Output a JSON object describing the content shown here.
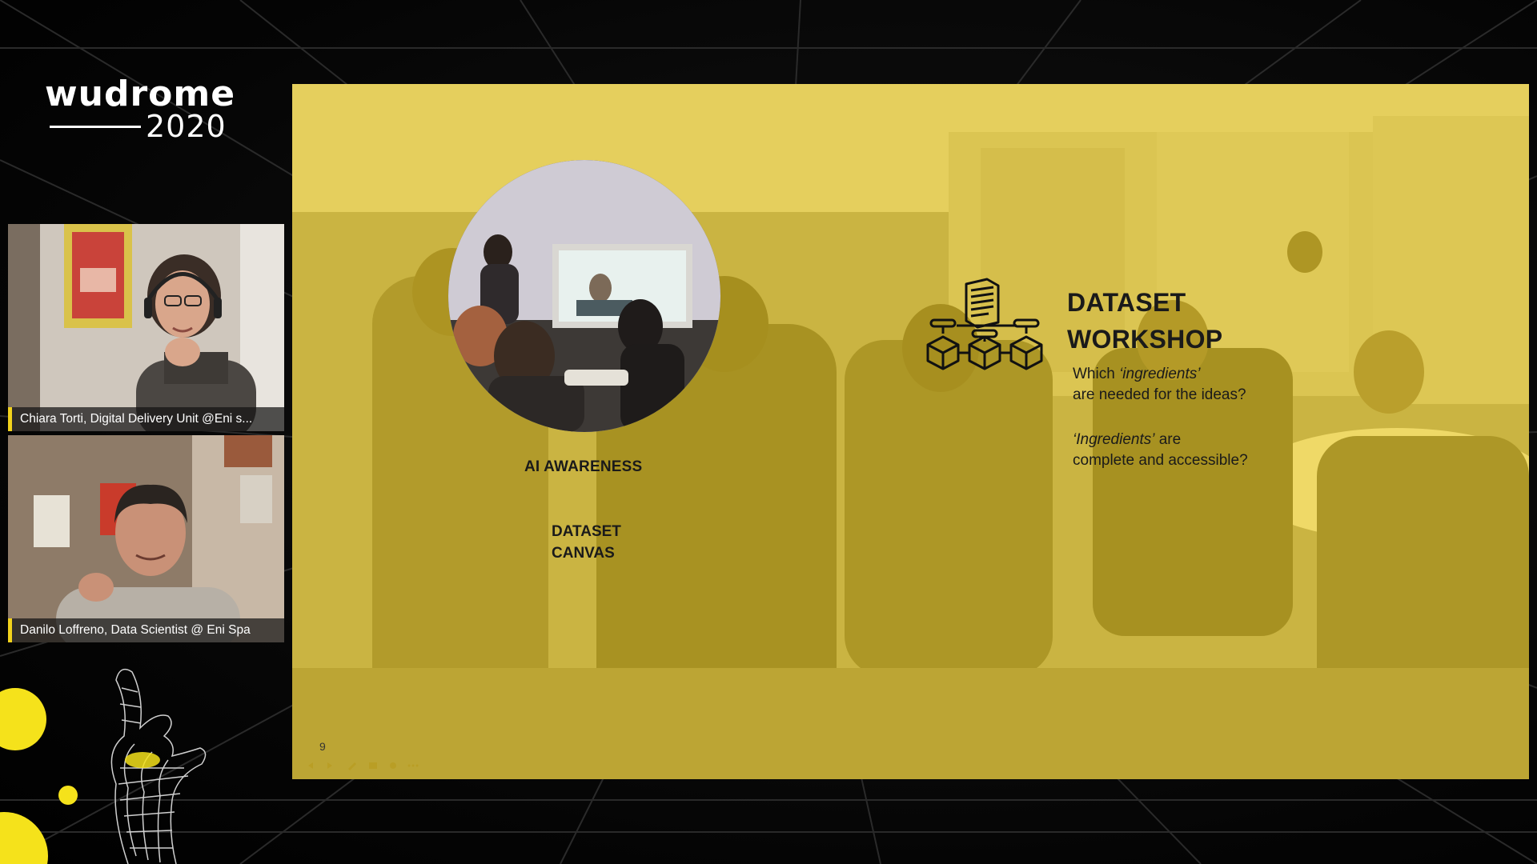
{
  "event": {
    "brand": "wudrome",
    "year": "2020"
  },
  "participants": [
    {
      "name": "Chiara Torti, Digital Delivery Unit @Eni s..."
    },
    {
      "name": "Danilo Loffreno, Data Scientist @ Eni Spa"
    }
  ],
  "slide": {
    "left_labels": {
      "ai_awareness": "AI AWARENESS",
      "dataset_canvas_line1": "DATASET",
      "dataset_canvas_line2": "CANVAS"
    },
    "workshop": {
      "title_line1": "DATASET",
      "title_line2": "WORKSHOP",
      "q1_prefix": "Which ",
      "q1_italic": "‘ingredients’",
      "q1_line2": "are needed for the ideas?",
      "q2_italic": "‘Ingredients’",
      "q2_suffix": " are",
      "q2_line2": "complete and accessible?"
    },
    "page_number": "9"
  },
  "colors": {
    "accent_yellow": "#f5e21b",
    "slide_tint": "#f4d214",
    "background": "#000000"
  },
  "icons": {
    "dataset": "document-with-connected-boxes-icon",
    "controls": "slide-navigation-controls"
  }
}
